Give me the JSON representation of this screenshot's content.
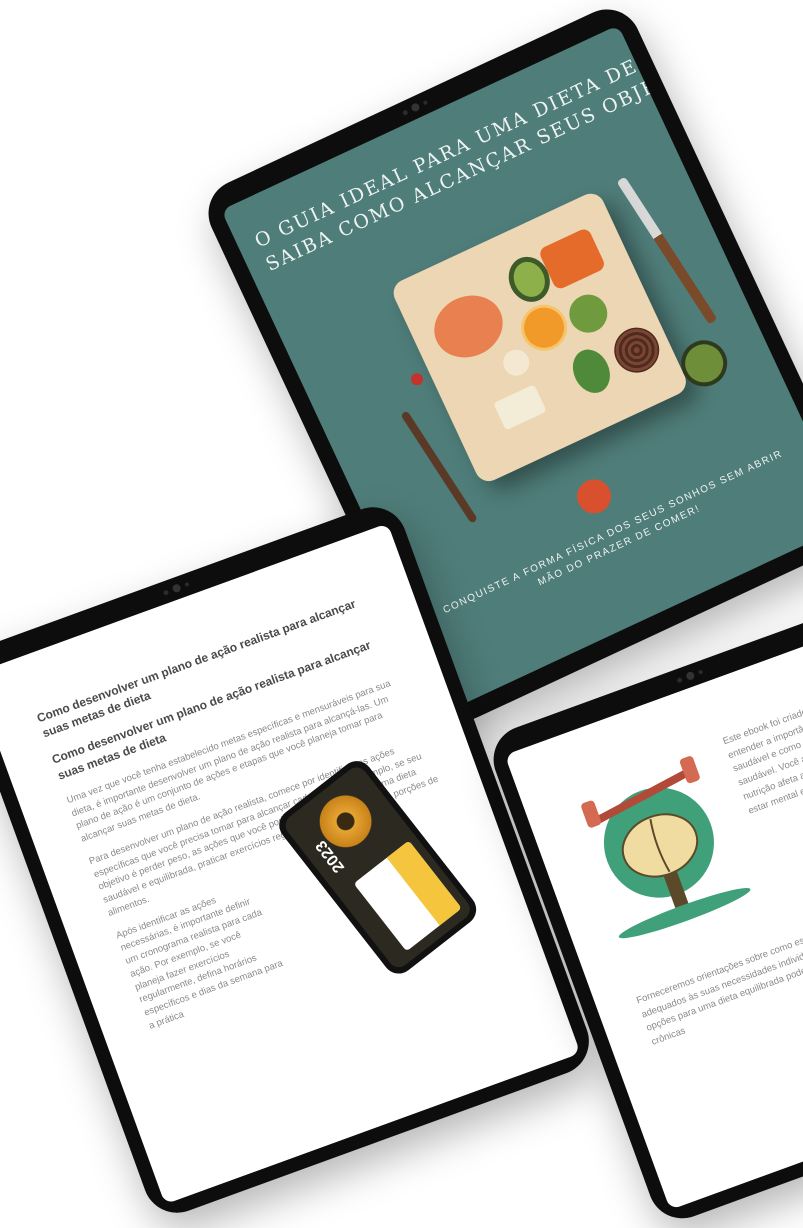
{
  "cover": {
    "title_line1": "O GUIA IDEAL PARA UMA DIETA DE SUCESSO",
    "title_line2": "SAIBA COMO ALCANÇAR SEUS OBJETIVOS",
    "tagline_line1": "CONQUISTE A FORMA FÍSICA DOS SEUS SONHOS SEM ABRIR",
    "tagline_line2": "MÃO DO PRAZER DE COMER!",
    "bg_color": "#4f7d79"
  },
  "left_page": {
    "heading_top": "Como desenvolver um plano de ação realista para alcançar suas metas de dieta",
    "heading_main": "Como desenvolver um plano de ação realista para alcançar suas metas de dieta",
    "paragraph1": "Uma vez que você tenha estabelecido metas específicas e mensuráveis para sua dieta, é importante desenvolver um plano de ação realista para alcançá-las. Um plano de ação é um conjunto de ações e etapas que você planeja tomar para alcançar suas metas de dieta.",
    "paragraph2": "Para desenvolver um plano de ação realista, comece por identificar as ações específicas que você precisa tomar para alcançar cada meta. Por exemplo, se seu objetivo é perder peso, as ações que você pode tomar incluem seguir uma dieta saudável e equilibrada, praticar exercícios regularmente e controlar suas porções de alimentos.",
    "paragraph3": "Após identificar as ações necessárias, é importante definir um cronograma realista para cada ação. Por exemplo, se você planeja fazer exercícios regularmente, defina horários específicos e dias da semana para a prática",
    "phone_year": "2023"
  },
  "right_page": {
    "paragraph1": "Este ebook foi criado para ajudá-lo a entender a importância de uma dieta saudável e como ela afeta sua vida saudável. Você aprenderá como a nutrição afeta a saúde física, o bem-estar mental e a energia, e como...",
    "paragraph2": "Forneceremos orientações sobre como escolher alimentos saudáveis e adequados às suas necessidades individuais, incluindo uma variedade de opções para uma dieta equilibrada pode ajudar a prevenir doenças crônicas"
  }
}
